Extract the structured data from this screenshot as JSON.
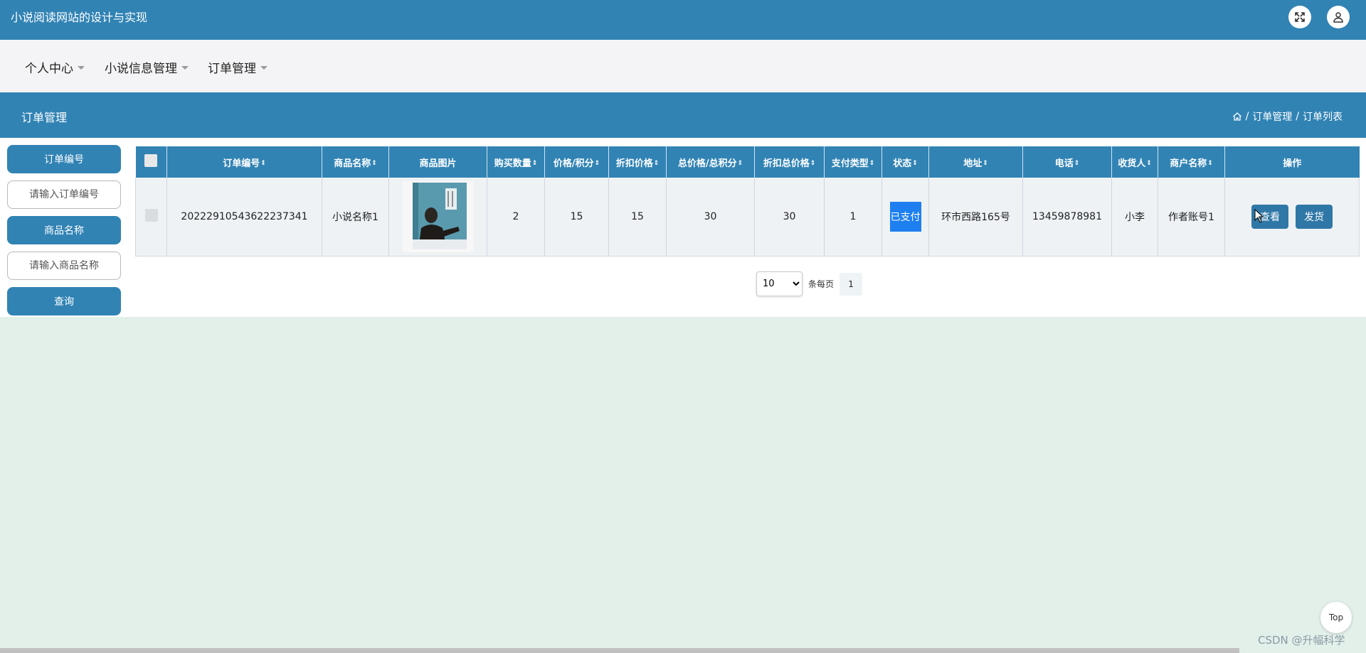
{
  "header": {
    "title": "小说阅读网站的设计与实现"
  },
  "nav": {
    "items": [
      {
        "label": "个人中心"
      },
      {
        "label": "小说信息管理"
      },
      {
        "label": "订单管理"
      }
    ]
  },
  "section": {
    "title": "订单管理",
    "breadcrumb": [
      "订单管理",
      "订单列表"
    ]
  },
  "search": {
    "order_no_label": "订单编号",
    "order_no_placeholder": "请输入订单编号",
    "product_name_label": "商品名称",
    "product_name_placeholder": "请输入商品名称",
    "query_button": "查询"
  },
  "table": {
    "columns": [
      "订单编号",
      "商品名称",
      "商品图片",
      "购买数量",
      "价格/积分",
      "折扣价格",
      "总价格/总积分",
      "折扣总价格",
      "支付类型",
      "状态",
      "地址",
      "电话",
      "收货人",
      "商户名称",
      "操作"
    ],
    "rows": [
      {
        "order_no": "20222910543622237341",
        "product_name": "小说名称1",
        "quantity": "2",
        "price": "15",
        "discount_price": "15",
        "total_price": "30",
        "discount_total": "30",
        "pay_type": "1",
        "status": "已支付",
        "address": "环市西路165号",
        "phone": "13459878981",
        "receiver": "小李",
        "merchant": "作者账号1",
        "actions": {
          "view": "查看",
          "ship": "发货"
        }
      }
    ]
  },
  "pagination": {
    "page_size": "10",
    "per_page_label": "条每页",
    "current_page": "1"
  },
  "top_button": "Top",
  "watermark": "CSDN @升幅科学"
}
